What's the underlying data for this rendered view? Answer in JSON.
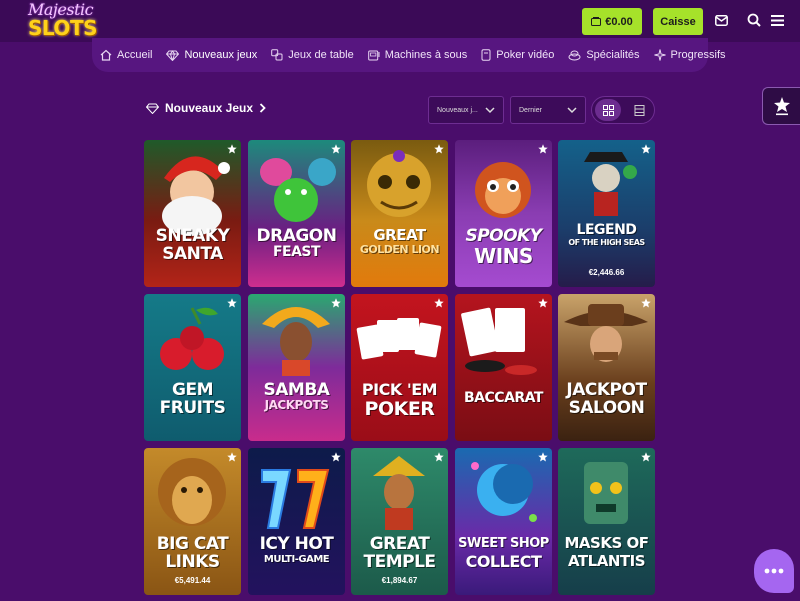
{
  "brand": {
    "line1": "Majestic",
    "line2": "SLOTS"
  },
  "header": {
    "balance": "€0.00",
    "cashier": "Caisse",
    "icons": [
      "mail-icon",
      "search-icon",
      "menu-icon"
    ]
  },
  "nav": [
    {
      "label": "Accueil",
      "icon": "home-icon"
    },
    {
      "label": "Nouveaux jeux",
      "icon": "diamond-icon"
    },
    {
      "label": "Jeux de table",
      "icon": "dice-icon"
    },
    {
      "label": "Machines à sous",
      "icon": "slot-machine-icon"
    },
    {
      "label": "Poker vidéo",
      "icon": "phone-card-icon"
    },
    {
      "label": "Spécialités",
      "icon": "coins-icon"
    },
    {
      "label": "Progressifs",
      "icon": "sparkle-icon"
    }
  ],
  "section": {
    "title": "Nouveaux Jeux",
    "filter1": "Nouveaux j...",
    "filter2": "Dernier"
  },
  "games": [
    {
      "t1": "SNEAKY",
      "t2": "SANTA",
      "jackpot": ""
    },
    {
      "t1": "DRAGON",
      "t2": "FEAST",
      "jackpot": ""
    },
    {
      "t1": "GREAT",
      "t2": "GOLDEN LION",
      "jackpot": ""
    },
    {
      "t1": "SPOOKY",
      "t2": "WINS",
      "jackpot": ""
    },
    {
      "t1": "LEGEND",
      "t2": "OF THE HIGH SEAS",
      "jackpot": "€2,446.66"
    },
    {
      "t1": "GEM",
      "t2": "FRUITS",
      "jackpot": ""
    },
    {
      "t1": "SAMBA",
      "t2": "JACKPOTS",
      "jackpot": ""
    },
    {
      "t1": "PICK 'EM",
      "t2": "POKER",
      "jackpot": ""
    },
    {
      "t1": "",
      "t2": "BACCARAT",
      "jackpot": ""
    },
    {
      "t1": "JACKPOT",
      "t2": "SALOON",
      "jackpot": ""
    },
    {
      "t1": "BIG CAT",
      "t2": "LINKS",
      "jackpot": "€5,491.44"
    },
    {
      "t1": "ICY HOT",
      "t2": "MULTI-GAME",
      "jackpot": ""
    },
    {
      "t1": "GREAT",
      "t2": "TEMPLE",
      "jackpot": "€1,894.67"
    },
    {
      "t1": "SWEET SHOP",
      "t2": "COLLECT",
      "jackpot": ""
    },
    {
      "t1": "MASKS OF",
      "t2": "ATLANTIS",
      "jackpot": ""
    }
  ],
  "colors": {
    "background": "#4a0d6b",
    "accent": "#a6e22a",
    "chat": "#a566f0"
  }
}
